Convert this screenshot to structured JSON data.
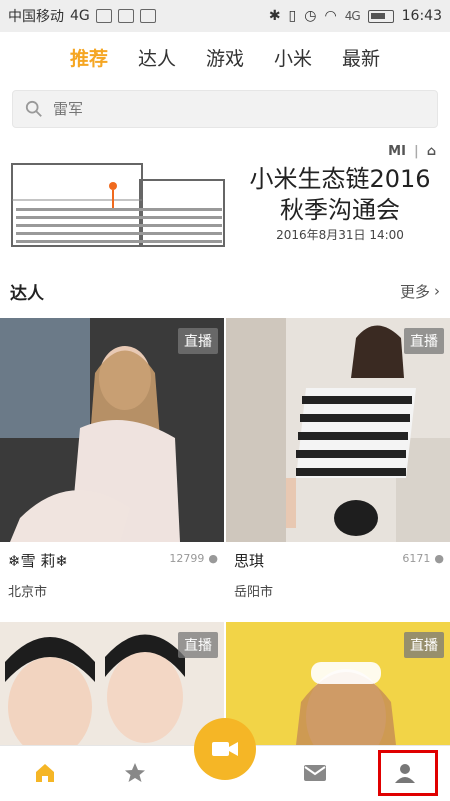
{
  "status": {
    "carrier": "中国移动",
    "network": "4G",
    "time": "16:43",
    "signal_label": "4G"
  },
  "tabs": [
    {
      "label": "推荐",
      "active": true
    },
    {
      "label": "达人",
      "active": false
    },
    {
      "label": "游戏",
      "active": false
    },
    {
      "label": "小米",
      "active": false
    },
    {
      "label": "最新",
      "active": false
    }
  ],
  "search": {
    "placeholder": "雷军"
  },
  "banner": {
    "brand": "MI",
    "title_line1": "小米生态链2016",
    "title_line2": "秋季沟通会",
    "date": "2016年8月31日 14:00"
  },
  "section": {
    "title": "达人",
    "more": "更多"
  },
  "cards": [
    {
      "name": "❄雪  莉❄",
      "views": "12799",
      "city": "北京市",
      "live": "直播"
    },
    {
      "name": "思琪",
      "views": "6171",
      "city": "岳阳市",
      "live": "直播"
    },
    {
      "name": "",
      "views": "",
      "city": "",
      "live": "直播"
    },
    {
      "name": "",
      "views": "",
      "city": "",
      "live": "直播"
    }
  ],
  "nav": [
    "home-icon",
    "star-icon",
    "video-icon",
    "mail-icon",
    "profile-icon"
  ],
  "colors": {
    "accent": "#f5a623",
    "highlight_box": "#e00000"
  }
}
